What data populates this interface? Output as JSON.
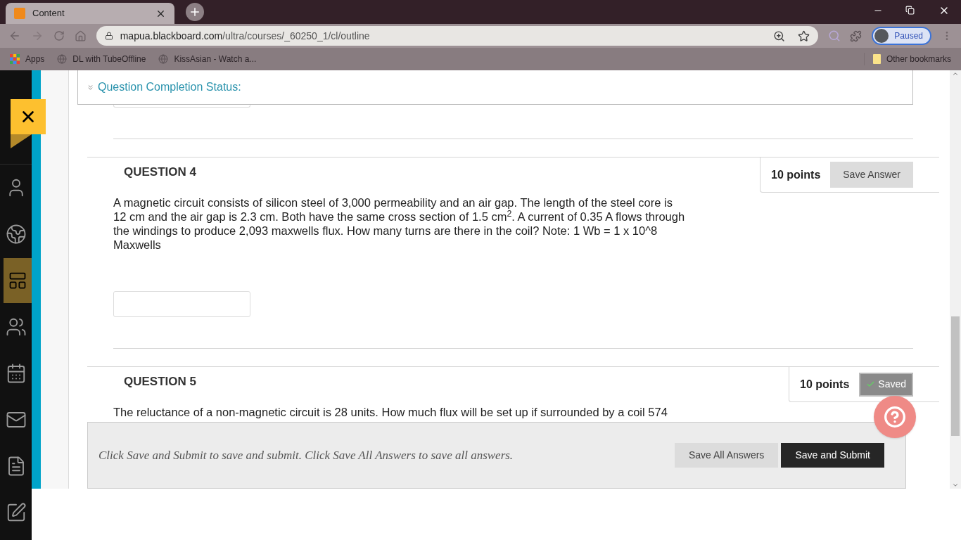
{
  "browser": {
    "tab": {
      "title": "Content"
    },
    "url": {
      "host": "mapua.blackboard.com",
      "path": "/ultra/courses/_60250_1/cl/outline"
    },
    "profile": {
      "label": "Paused"
    },
    "bookmarks": [
      {
        "label": "Apps",
        "kind": "apps"
      },
      {
        "label": "DL with TubeOffline",
        "kind": "site"
      },
      {
        "label": "KissAsian - Watch a...",
        "kind": "site"
      }
    ],
    "other_bookmarks": "Other bookmarks"
  },
  "sidebar": {
    "items": [
      {
        "kind": "profile",
        "selected": false
      },
      {
        "kind": "globe",
        "selected": false
      },
      {
        "kind": "courses",
        "selected": true
      },
      {
        "kind": "groups",
        "selected": false
      },
      {
        "kind": "calendar",
        "selected": false
      },
      {
        "kind": "mail",
        "selected": false
      },
      {
        "kind": "grades",
        "selected": false
      },
      {
        "kind": "edit",
        "selected": false
      }
    ]
  },
  "completion_status": {
    "label": "Question Completion Status:"
  },
  "questions": [
    {
      "title": "QUESTION 4",
      "points": "10 points",
      "saved": false,
      "button": "Save Answer",
      "answer_field": true,
      "text": "A magnetic circuit consists of silicon steel of 3,000 permeability and an air gap. The length of the steel core is 12 cm and the air gap is 2.3 cm. Both have the same cross section of 1.5 cm$^{2}$. A current of 0.35 A flows through the windings to produce 2,093 maxwells flux. How many turns are there in the coil? Note: 1 Wb = 1 x 10^8 Maxwells"
    },
    {
      "title": "QUESTION 5",
      "points": "10 points",
      "saved": true,
      "button": "Saved",
      "answer_field": false,
      "text": "The reluctance of a non-magnetic circuit is 28 units. How much flux will be set up if surrounded by a coil 574"
    }
  ],
  "footer": {
    "instruction": "Click Save and Submit to save and submit. Click Save All Answers to save all answers.",
    "buttons": [
      {
        "label": "Save All Answers",
        "kind": "secondary"
      },
      {
        "label": "Save and Submit",
        "kind": "primary"
      }
    ]
  }
}
